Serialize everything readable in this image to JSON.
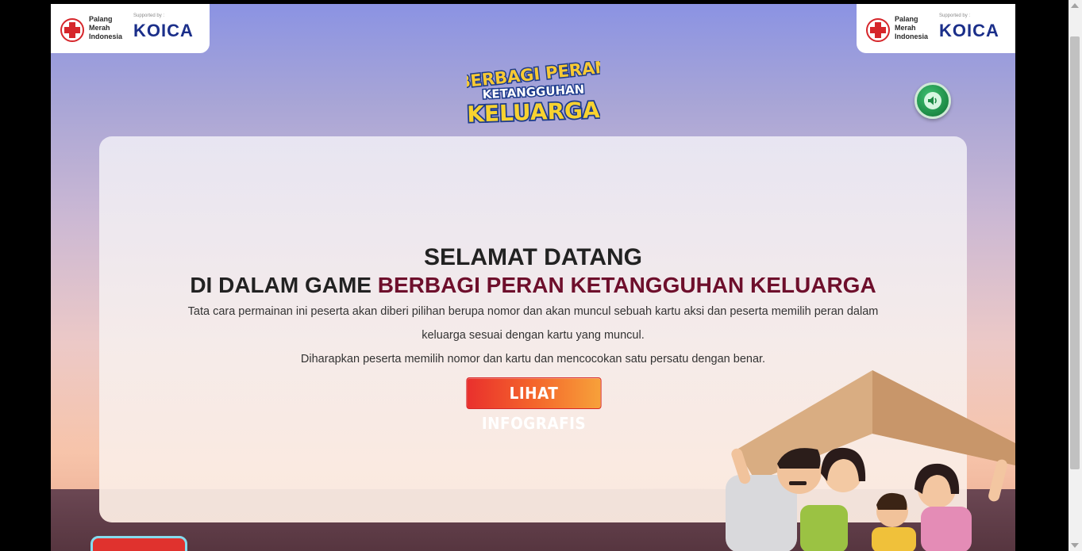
{
  "header": {
    "left_logo": {
      "org_lines": [
        "Palang",
        "Merah",
        "Indonesia"
      ],
      "supported_by": "Supported by :",
      "sponsor": "KOICA"
    },
    "right_logo": {
      "org_lines": [
        "Palang",
        "Merah",
        "Indonesia"
      ],
      "supported_by": "Supported by :",
      "sponsor": "KOICA"
    },
    "game_logo_lines": [
      "BERBAGI PERAN",
      "KETANGGUHAN",
      "KELUARGA"
    ]
  },
  "controls": {
    "sound_icon": "speaker-icon"
  },
  "welcome": {
    "title": "SELAMAT DATANG",
    "subtitle_prefix": "DI DALAM GAME ",
    "subtitle_highlight": "BERBAGI PERAN KETANGGUHAN KELUARGA",
    "paragraph_1": "Tata cara permainan ini peserta akan diberi pilihan berupa nomor dan akan muncul sebuah kartu aksi dan peserta memilih peran dalam keluarga sesuai dengan kartu yang muncul.",
    "paragraph_2": "Diharapkan peserta memilih nomor dan kartu dan mencocokan satu persatu dengan benar.",
    "button_label": "LIHAT INFOGRAFIS"
  },
  "colors": {
    "highlight": "#6e0f2c",
    "button_start": "#e9302d",
    "button_end": "#f7a13a",
    "sound_button": "#1d8a45",
    "sponsor_text": "#1b2f8a"
  }
}
